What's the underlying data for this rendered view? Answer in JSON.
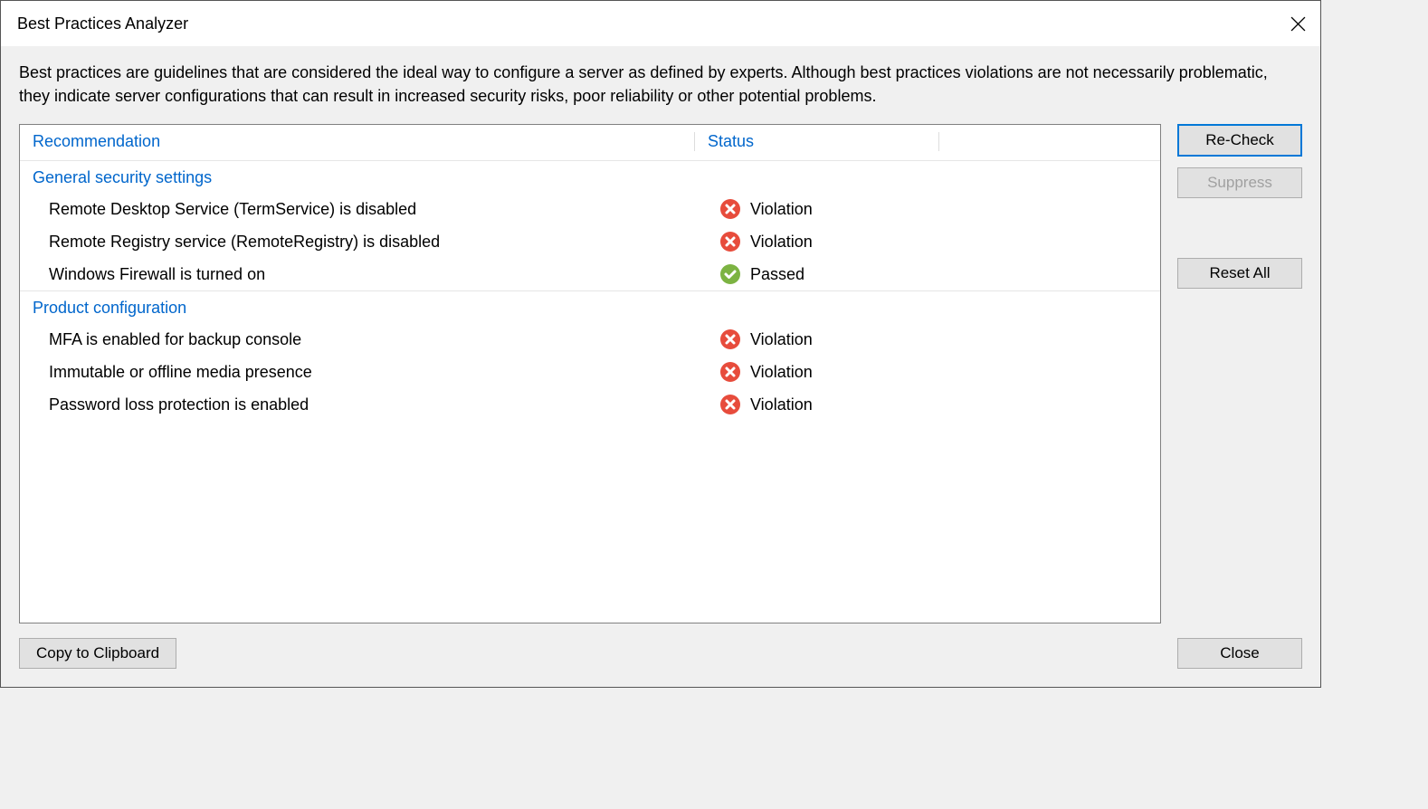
{
  "dialog": {
    "title": "Best Practices Analyzer",
    "description": "Best practices are guidelines that are considered the ideal way to configure a server as defined by experts. Although best practices violations are not necessarily problematic, they indicate server configurations that can result in increased security risks, poor reliability or other potential problems."
  },
  "columns": {
    "recommendation": "Recommendation",
    "status": "Status"
  },
  "sections": [
    {
      "title": "General security settings",
      "rows": [
        {
          "reco": "Remote Desktop Service (TermService) is disabled",
          "status": "Violation",
          "icon": "violation"
        },
        {
          "reco": "Remote Registry service (RemoteRegistry) is disabled",
          "status": "Violation",
          "icon": "violation"
        },
        {
          "reco": "Windows Firewall is turned on",
          "status": "Passed",
          "icon": "passed"
        }
      ]
    },
    {
      "title": "Product configuration",
      "rows": [
        {
          "reco": "MFA is enabled for backup console",
          "status": "Violation",
          "icon": "violation"
        },
        {
          "reco": "Immutable or offline media presence",
          "status": "Violation",
          "icon": "violation"
        },
        {
          "reco": "Password loss protection is enabled",
          "status": "Violation",
          "icon": "violation"
        }
      ]
    }
  ],
  "buttons": {
    "recheck": "Re-Check",
    "suppress": "Suppress",
    "resetAll": "Reset All",
    "copy": "Copy to Clipboard",
    "close": "Close"
  },
  "statusIcons": {
    "violation": "violation-icon",
    "passed": "passed-icon"
  }
}
